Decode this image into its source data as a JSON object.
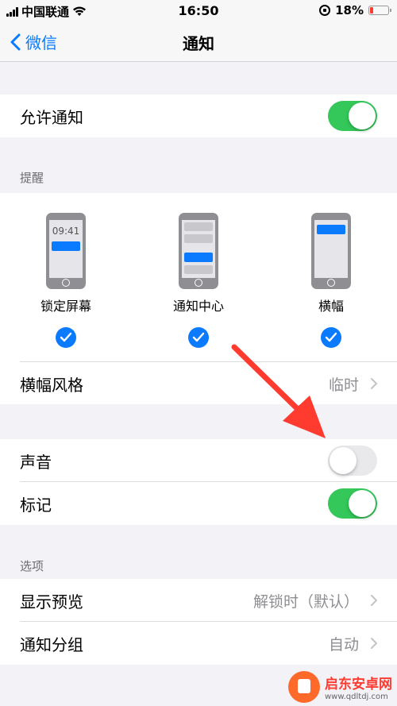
{
  "status": {
    "carrier": "中国联通",
    "time": "16:50",
    "battery_percent": "18%",
    "battery_level": 0.18,
    "icons": [
      "signal-icon",
      "wifi-icon",
      "rotation-lock-icon",
      "battery-icon"
    ]
  },
  "nav": {
    "back_label": "微信",
    "title": "通知"
  },
  "allow": {
    "label": "允许通知",
    "on": true
  },
  "alerts": {
    "header": "提醒",
    "options": [
      {
        "label": "锁定屏幕",
        "preview_time": "09:41",
        "checked": true
      },
      {
        "label": "通知中心",
        "checked": true
      },
      {
        "label": "横幅",
        "checked": true
      }
    ],
    "banner_style": {
      "label": "横幅风格",
      "value": "临时"
    }
  },
  "sounds": {
    "label": "声音",
    "on": false
  },
  "badges": {
    "label": "标记",
    "on": true
  },
  "options": {
    "header": "选项",
    "show_previews": {
      "label": "显示预览",
      "value": "解锁时（默认）"
    },
    "grouping": {
      "label": "通知分组",
      "value": "自动"
    }
  },
  "watermark": {
    "title": "启东安卓网",
    "url": "www.qdltdj.com"
  },
  "colors": {
    "accent": "#0a7aff",
    "toggle_on": "#34c759",
    "toggle_off": "#e9e9eb",
    "arrow": "#ff3b30"
  }
}
